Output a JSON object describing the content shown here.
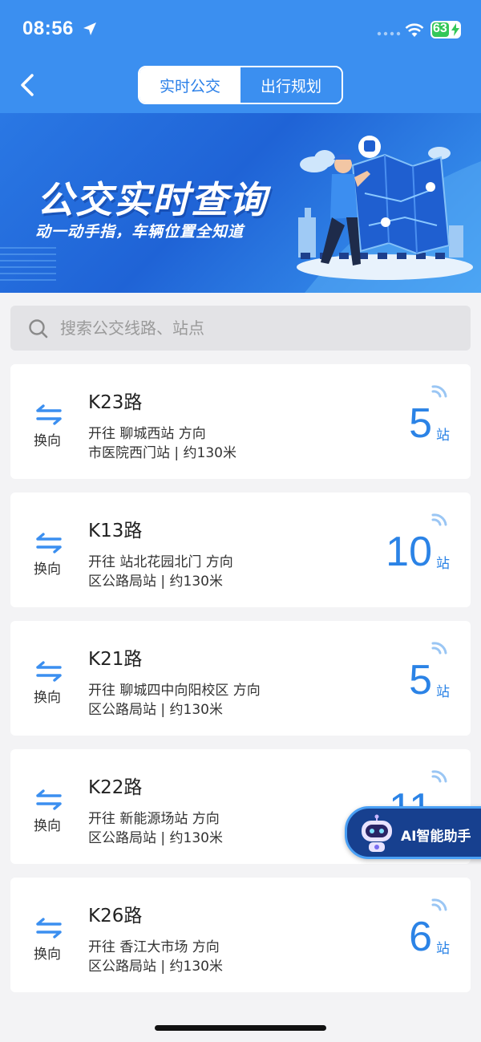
{
  "status_bar": {
    "time": "08:56",
    "battery": "63",
    "battery_level": 0.63
  },
  "header": {
    "tabs": [
      {
        "label": "实时公交",
        "active": true
      },
      {
        "label": "出行规划",
        "active": false
      }
    ]
  },
  "banner": {
    "title": "公交实时查询",
    "subtitle": "动一动手指，车辆位置全知道"
  },
  "search": {
    "placeholder": "搜索公交线路、站点"
  },
  "routes": [
    {
      "name": "K23路",
      "direction": "开往 聊城西站 方向",
      "distance": "市医院西门站 | 约130米",
      "stops": "5",
      "stops_unit": "站",
      "swap_label": "换向"
    },
    {
      "name": "K13路",
      "direction": "开往 站北花园北门 方向",
      "distance": "区公路局站 | 约130米",
      "stops": "10",
      "stops_unit": "站",
      "swap_label": "换向"
    },
    {
      "name": "K21路",
      "direction": "开往 聊城四中向阳校区 方向",
      "distance": "区公路局站 | 约130米",
      "stops": "5",
      "stops_unit": "站",
      "swap_label": "换向"
    },
    {
      "name": "K22路",
      "direction": "开往 新能源场站 方向",
      "distance": "区公路局站 | 约130米",
      "stops": "11",
      "stops_unit": "站",
      "swap_label": "换向"
    },
    {
      "name": "K26路",
      "direction": "开往 香江大市场 方向",
      "distance": "区公路局站 | 约130米",
      "stops": "6",
      "stops_unit": "站",
      "swap_label": "换向"
    }
  ],
  "ai_assistant": {
    "label": "AI智能助手"
  },
  "colors": {
    "header_blue": "#3b8ff0",
    "accent_blue": "#2b83e6",
    "battery_green": "#34c759",
    "ai_navy": "#17408f"
  }
}
